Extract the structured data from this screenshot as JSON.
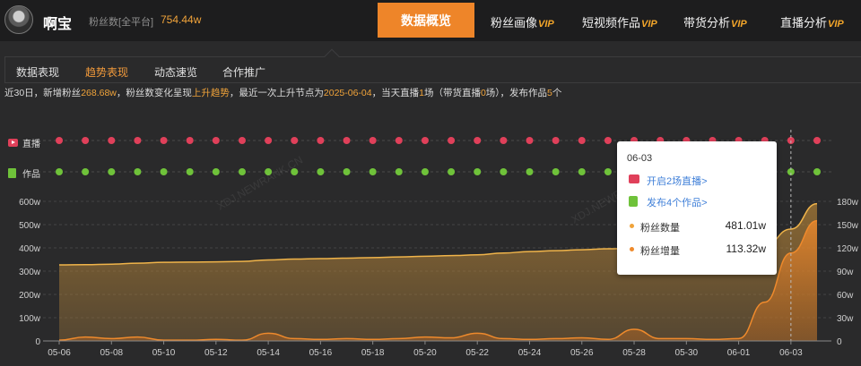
{
  "header": {
    "account_name": "啊宝",
    "fans_label": "粉丝数[全平台]",
    "fans_value": "754.44w",
    "nav_active": "数据概览",
    "nav_items": [
      {
        "label": "粉丝画像",
        "vip": "VIP"
      },
      {
        "label": "短视频作品",
        "vip": "VIP"
      },
      {
        "label": "带货分析",
        "vip": "VIP"
      },
      {
        "label": "直播分析",
        "vip": "VIP"
      }
    ]
  },
  "subnav": {
    "tabs": [
      "数据表现",
      "趋势表现",
      "动态速览",
      "合作推广"
    ],
    "active_index": 1
  },
  "summary": {
    "p1": "近30日，新增粉丝",
    "new_fans": "268.68w",
    "p2": "，粉丝数变化呈现",
    "trend": "上升趋势",
    "p3": "，最近一次上升节点为",
    "last_date": "2025-06-04",
    "p4": "，当天直播",
    "live_count": "1",
    "p5": "场（带货直播",
    "sale_live_count": "0",
    "p6": "场），发布作品",
    "works_count": "5",
    "p7": "个"
  },
  "legend_rows": {
    "live_label": "直播",
    "works_label": "作品"
  },
  "watermark": "XDJ.NEWRANK.CN",
  "tooltip": {
    "date": "06-03",
    "live_link": "开启2场直播>",
    "works_link": "发布4个作品>",
    "fans_label": "粉丝数量",
    "fans_value": "481.01w",
    "growth_label": "粉丝增量",
    "growth_value": "113.32w"
  },
  "colors": {
    "accent": "#ee8529",
    "fans_line": "#f0b44a",
    "growth_line": "#ef8a2c",
    "live_dot": "#e0405a",
    "works_dot": "#6fc23a"
  },
  "chart_data": {
    "type": "area",
    "x": [
      "05-06",
      "05-07",
      "05-08",
      "05-09",
      "05-10",
      "05-11",
      "05-12",
      "05-13",
      "05-14",
      "05-15",
      "05-16",
      "05-17",
      "05-18",
      "05-19",
      "05-20",
      "05-21",
      "05-22",
      "05-23",
      "05-24",
      "05-25",
      "05-26",
      "05-27",
      "05-28",
      "05-29",
      "05-30",
      "05-31",
      "06-01",
      "06-02",
      "06-03",
      "06-04"
    ],
    "x_tick_labels": [
      "05-06",
      "05-08",
      "05-10",
      "05-12",
      "05-14",
      "05-16",
      "05-18",
      "05-20",
      "05-22",
      "05-24",
      "05-26",
      "05-28",
      "05-30",
      "06-01",
      "06-03"
    ],
    "series": [
      {
        "name": "粉丝数量",
        "axis": "left",
        "values": [
          327,
          328,
          330,
          334,
          338,
          339,
          340,
          342,
          348,
          352,
          354,
          356,
          358,
          361,
          364,
          367,
          370,
          378,
          384,
          388,
          392,
          396,
          398,
          400,
          401,
          402,
          404,
          410,
          481,
          590
        ]
      },
      {
        "name": "粉丝增量",
        "axis": "right",
        "values": [
          1,
          5,
          3,
          5,
          1,
          1,
          2,
          1,
          10,
          3,
          2,
          3,
          2,
          3,
          5,
          4,
          10,
          3,
          2,
          3,
          4,
          2,
          15,
          3,
          3,
          2,
          3,
          50,
          113.32,
          155
        ]
      }
    ],
    "y_left_ticks": [
      "0",
      "100w",
      "200w",
      "300w",
      "400w",
      "500w",
      "600w"
    ],
    "y_left_range": [
      0,
      600
    ],
    "y_right_ticks": [
      "0",
      "30w",
      "60w",
      "90w",
      "120w",
      "150w",
      "180w"
    ],
    "y_right_range": [
      0,
      180
    ],
    "live_markers": "daily",
    "works_markers": "daily",
    "grid": true
  }
}
